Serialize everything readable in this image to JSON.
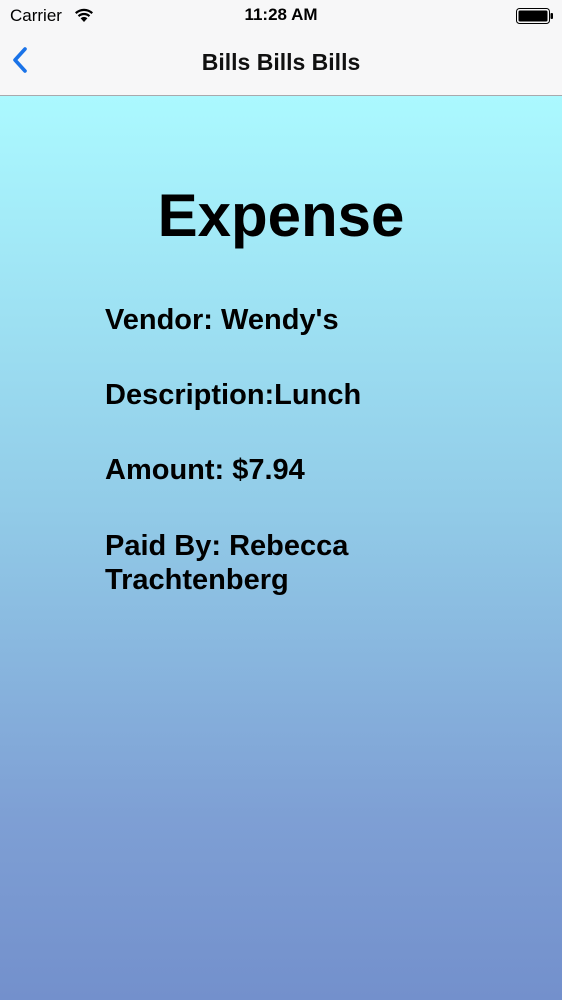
{
  "status_bar": {
    "carrier": "Carrier",
    "time": "11:28 AM",
    "icons": [
      "wifi-icon",
      "battery-icon"
    ]
  },
  "nav": {
    "title": "Bills Bills Bills",
    "back_icon": "chevron-left-icon",
    "accent_color": "#1a73e8"
  },
  "expense": {
    "heading": "Expense",
    "vendor": "Vendor: Wendy's",
    "description": "Description:Lunch",
    "amount": "Amount: $7.94",
    "paid_by": "Paid By: Rebecca Trachtenberg"
  },
  "colors": {
    "gradient_top": "#abf9ff",
    "gradient_bottom": "#7390cc"
  }
}
